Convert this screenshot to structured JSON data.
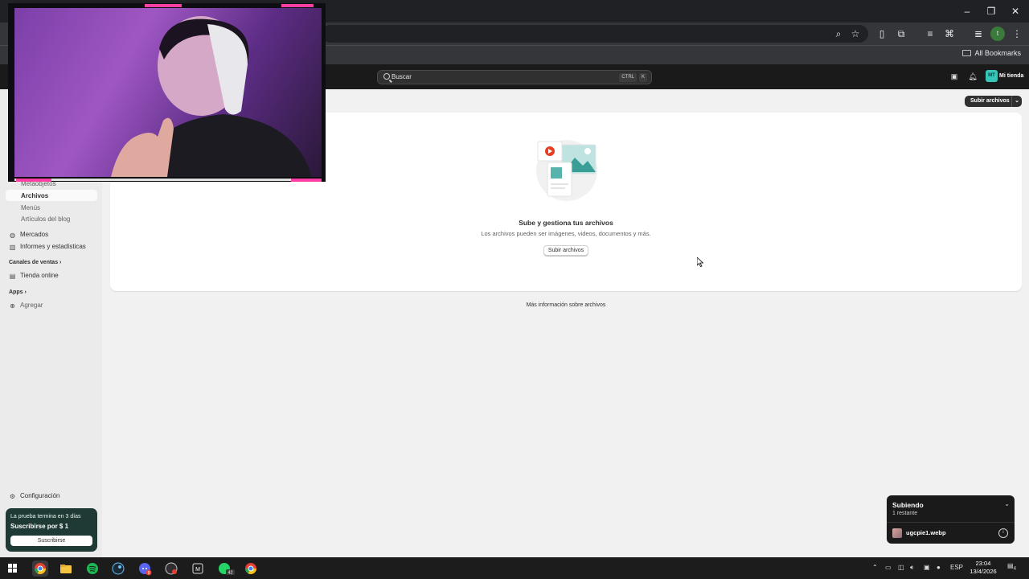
{
  "browser": {
    "bookmarks_label": "All Bookmarks",
    "window_controls": [
      "–",
      "❐",
      "✕"
    ],
    "profile_initial": "t"
  },
  "admin": {
    "search": {
      "placeholder": "Buscar",
      "shortcut_ctrl": "CTRL",
      "shortcut_key": "K"
    },
    "store": {
      "initials": "MT",
      "name": "Mi tienda"
    }
  },
  "sidebar": {
    "sub_items": [
      "Metaobjetos",
      "Archivos",
      "Menús",
      "Artículos del blog"
    ],
    "items": [
      {
        "label": "Mercados",
        "icon": "globe-icon"
      },
      {
        "label": "Informes y estadísticas",
        "icon": "bar-chart-icon"
      }
    ],
    "sales_channels_label": "Canales de ventas",
    "online_store": "Tienda online",
    "apps_label": "Apps",
    "add_label": "Agregar",
    "settings_label": "Configuración",
    "trial": {
      "line1": "La prueba termina en 3 días",
      "line2": "Suscribirse por $ 1",
      "button": "Suscribirse"
    }
  },
  "main": {
    "upload_button": "Subir archivos",
    "empty_title": "Sube y gestiona tus archivos",
    "empty_subtitle": "Los archivos pueden ser imágenes, videos, documentos y más.",
    "empty_button": "Subir archivos",
    "more_info": "Más información sobre archivos"
  },
  "upload_toast": {
    "title": "Subiendo",
    "remaining": "1 restante",
    "file_name": "ugcpie1.webp"
  },
  "taskbar": {
    "whatsapp_badge": "42",
    "discord_badge": "9",
    "language": "ESP",
    "time": "23:04",
    "date": "13/4/2026",
    "notifications": "4"
  },
  "colors": {
    "admin_bar": "#1a1a1a",
    "trial_bg": "#1f3a34",
    "store_badge": "#36c5b7",
    "webcam_accent": "#ff3fa6"
  }
}
